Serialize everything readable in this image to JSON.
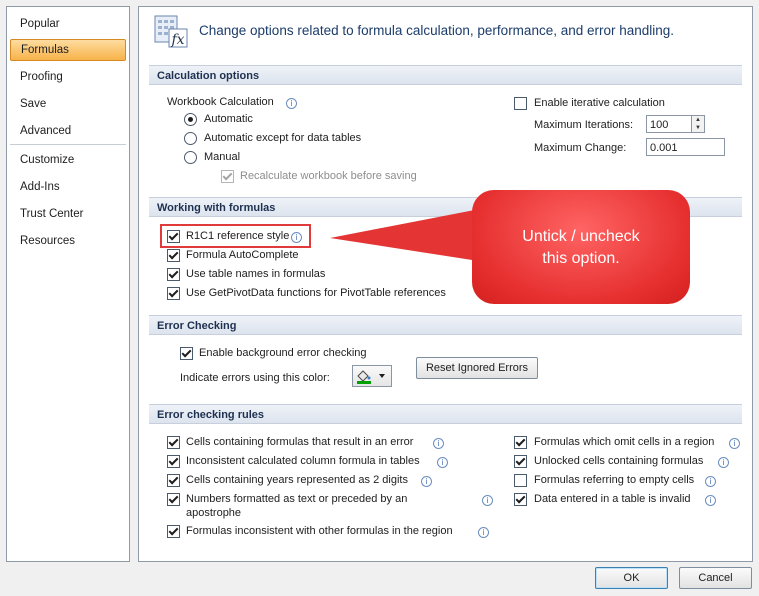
{
  "sidebar": {
    "items": [
      {
        "label": "Popular"
      },
      {
        "label": "Formulas",
        "active": true
      },
      {
        "label": "Proofing"
      },
      {
        "label": "Save"
      },
      {
        "label": "Advanced"
      },
      {
        "label": "Customize"
      },
      {
        "label": "Add-Ins"
      },
      {
        "label": "Trust Center"
      },
      {
        "label": "Resources"
      }
    ]
  },
  "header": {
    "text": "Change options related to formula calculation, performance, and error handling.",
    "icon": "fx-formula-icon"
  },
  "calc": {
    "section_title": "Calculation options",
    "workbook_label": "Workbook Calculation",
    "radio_automatic": "Automatic",
    "radio_except": "Automatic except for data tables",
    "radio_manual": "Manual",
    "recalc_label": "Recalculate workbook before saving",
    "iterative_label": "Enable iterative calculation",
    "max_iter_label": "Maximum Iterations:",
    "max_iter_value": "100",
    "max_change_label": "Maximum Change:",
    "max_change_value": "0.001"
  },
  "working": {
    "section_title": "Working with formulas",
    "r1c1": "R1C1 reference style",
    "autocomplete": "Formula AutoComplete",
    "table_names": "Use table names in formulas",
    "getpivot": "Use GetPivotData functions for PivotTable references"
  },
  "errcheck": {
    "section_title": "Error Checking",
    "enable_bg": "Enable background error checking",
    "indicate": "Indicate errors using this color:",
    "reset_btn": "Reset Ignored Errors",
    "indicator_color": "#00a000"
  },
  "rules": {
    "section_title": "Error checking rules",
    "left": [
      {
        "label": "Cells containing formulas that result in an error"
      },
      {
        "label": "Inconsistent calculated column formula in tables"
      },
      {
        "label": "Cells containing years represented as 2 digits"
      },
      {
        "label": "Numbers formatted as text or preceded by an",
        "label2": "apostrophe"
      },
      {
        "label": "Formulas inconsistent with other formulas in the region"
      }
    ],
    "right": [
      {
        "label": "Formulas which omit cells in a region",
        "checked": true
      },
      {
        "label": "Unlocked cells containing formulas",
        "checked": true
      },
      {
        "label": "Formulas referring to empty cells",
        "checked": false
      },
      {
        "label": "Data entered in a table is invalid",
        "checked": true
      }
    ]
  },
  "footer": {
    "ok": "OK",
    "cancel": "Cancel"
  },
  "annotation": {
    "line1": "Untick / uncheck",
    "line2": "this option.",
    "color": "#e53a3a"
  }
}
